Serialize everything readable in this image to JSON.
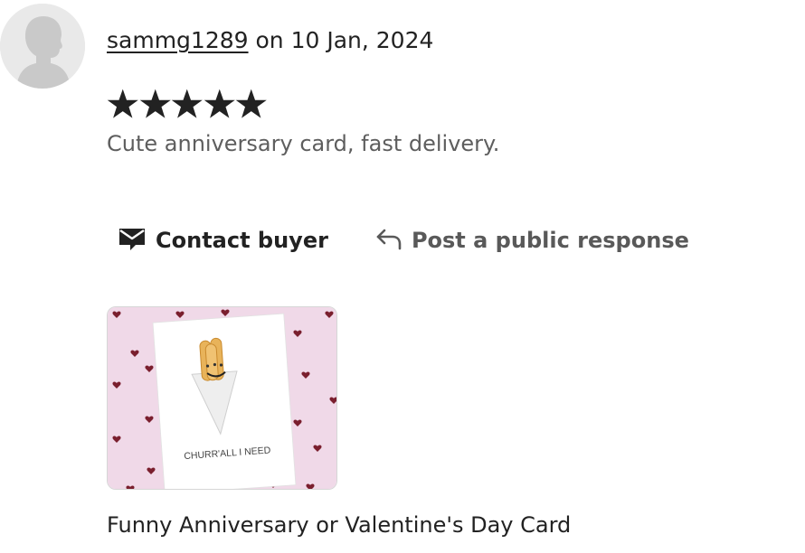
{
  "review": {
    "username": "sammg1289",
    "date_text": " on 10 Jan, 2024",
    "rating": 5,
    "rating_max": 5,
    "text": "Cute anniversary card, fast delivery."
  },
  "actions": {
    "contact_label": "Contact buyer",
    "contact_icon": "envelope-icon",
    "respond_label": "Post a public response",
    "respond_icon": "reply-arrow-icon"
  },
  "listing": {
    "title": "Funny Anniversary or Valentine's Day Card",
    "card_caption": "CHURR'ALL I NEED"
  },
  "colors": {
    "text": "#222222",
    "muted": "#5e5e5e",
    "star": "#222222",
    "thumb_bg": "#f0d9e8",
    "heart": "#7a1f2e"
  }
}
